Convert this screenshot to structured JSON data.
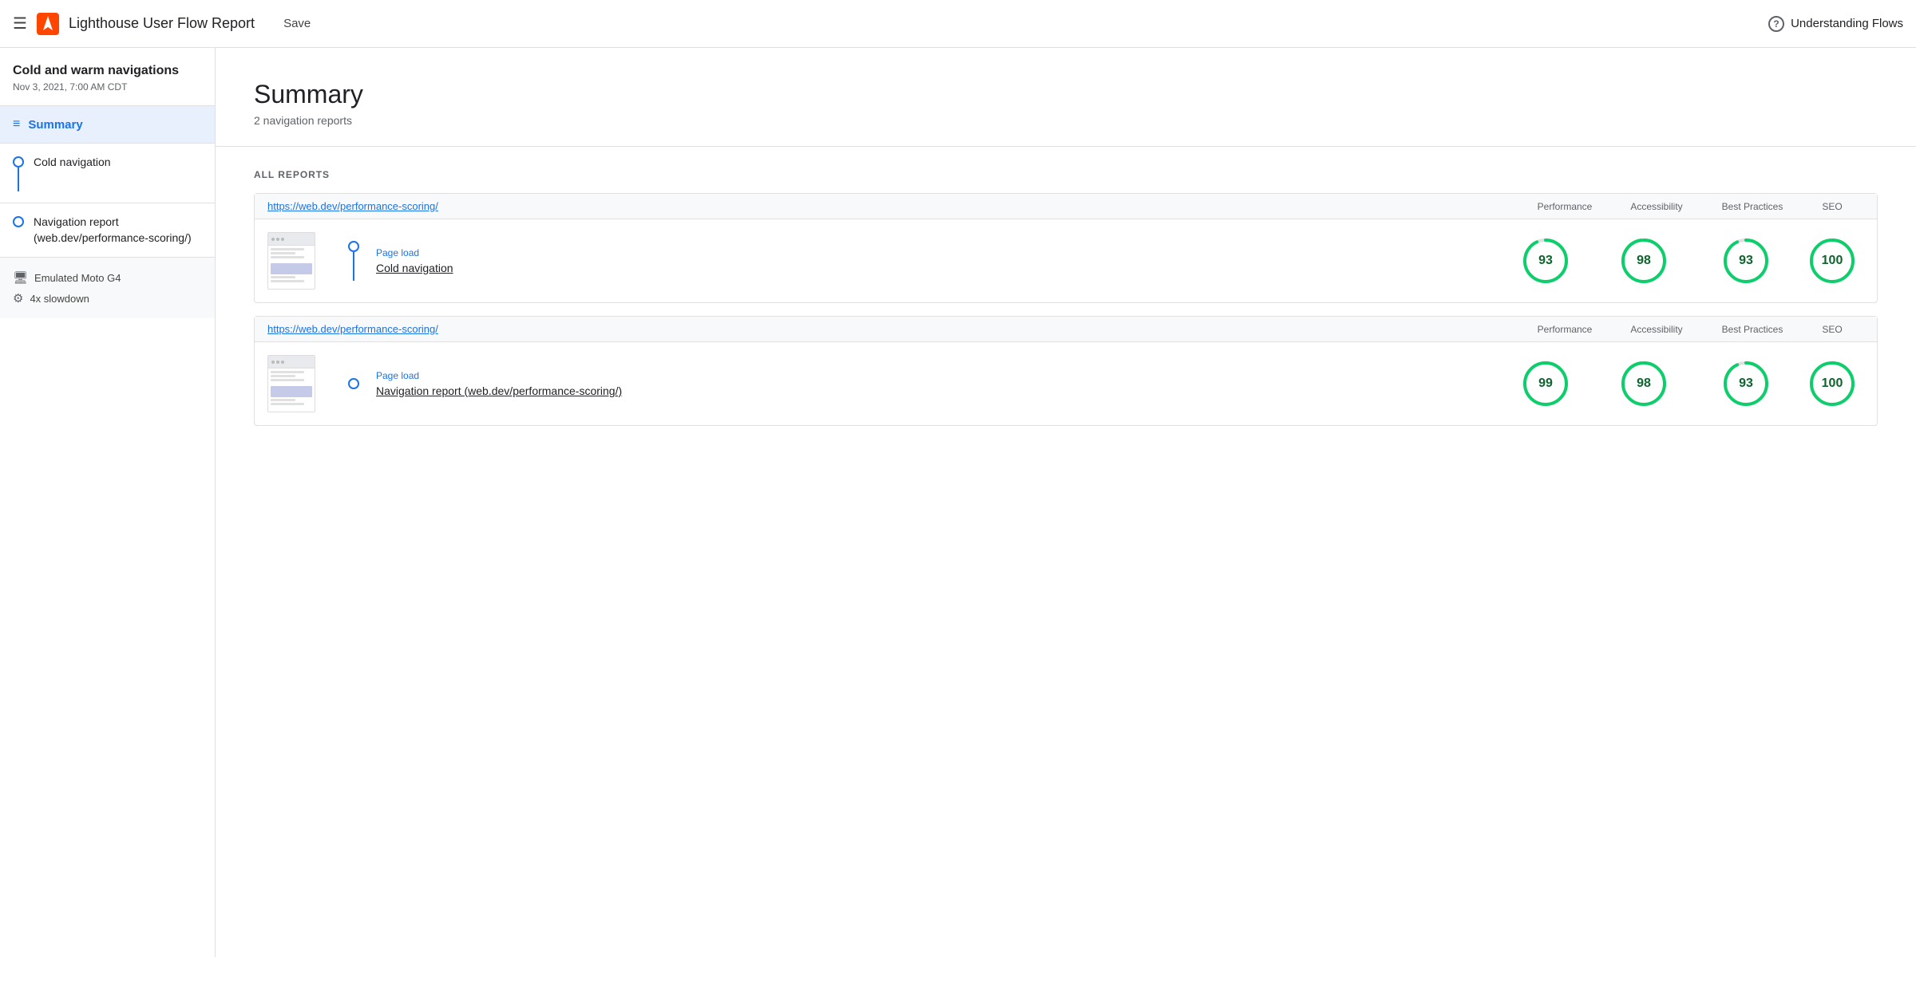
{
  "header": {
    "menu_icon": "☰",
    "title": "Lighthouse User Flow Report",
    "save_label": "Save",
    "help_icon": "?",
    "understanding_flows_label": "Understanding Flows"
  },
  "sidebar": {
    "project_title": "Cold and warm navigations",
    "project_date": "Nov 3, 2021, 7:00 AM CDT",
    "summary_label": "Summary",
    "flow_items": [
      {
        "label": "Cold navigation",
        "has_line_below": true
      },
      {
        "label": "Navigation report (web.dev/performance-scoring/)",
        "has_line_below": false
      }
    ],
    "device_items": [
      {
        "label": "Emulated Moto G4",
        "icon_type": "device"
      },
      {
        "label": "4x slowdown",
        "icon_type": "cpu"
      }
    ]
  },
  "main": {
    "summary_title": "Summary",
    "summary_subtitle": "2 navigation reports",
    "all_reports_label": "ALL REPORTS",
    "reports": [
      {
        "url": "https://web.dev/performance-scoring/",
        "columns": [
          "Performance",
          "Accessibility",
          "Best Practices",
          "SEO"
        ],
        "type_label": "Page load",
        "name": "Cold navigation",
        "scores": [
          93,
          98,
          93,
          100
        ],
        "score_colors": [
          "#0d652d",
          "#0d652d",
          "#0d652d",
          "#0d652d"
        ]
      },
      {
        "url": "https://web.dev/performance-scoring/",
        "columns": [
          "Performance",
          "Accessibility",
          "Best Practices",
          "SEO"
        ],
        "type_label": "Page load",
        "name": "Navigation report (web.dev/performance-scoring/)",
        "scores": [
          99,
          98,
          93,
          100
        ],
        "score_colors": [
          "#0d652d",
          "#0d652d",
          "#0d652d",
          "#0d652d"
        ]
      }
    ]
  }
}
